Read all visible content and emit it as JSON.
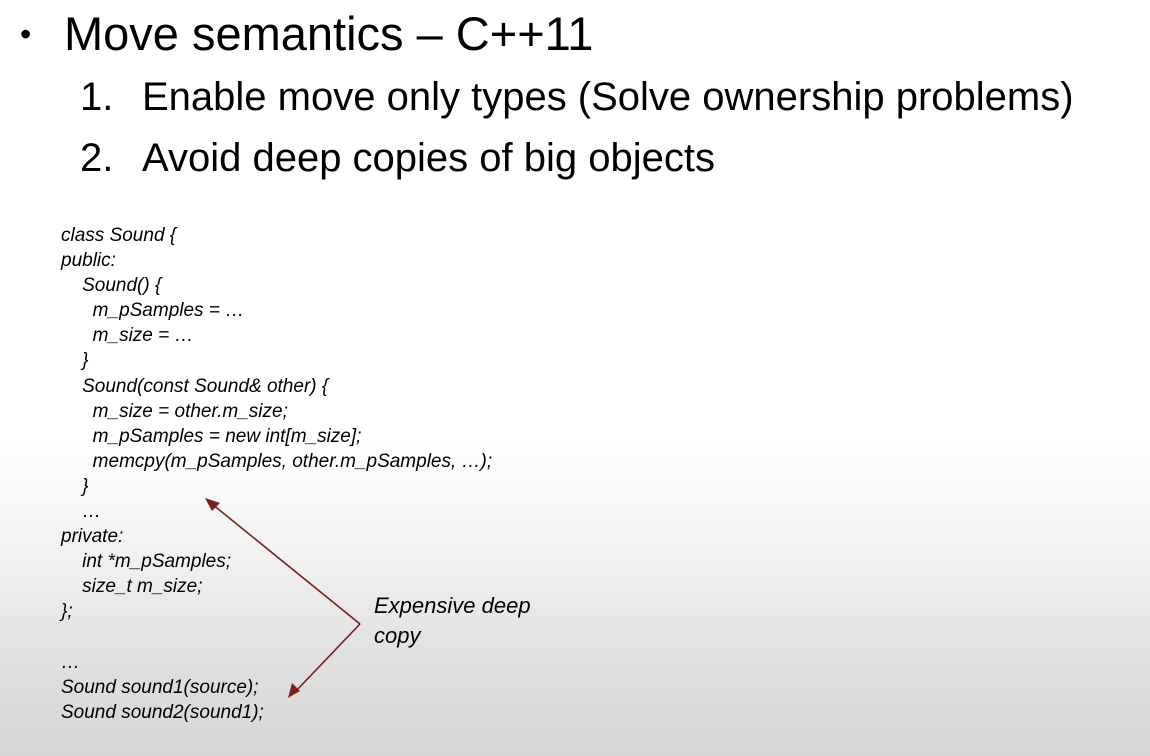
{
  "slide": {
    "bullet": "•",
    "heading": "Move semantics – C++11",
    "items": [
      {
        "num": "1.",
        "text": "Enable move only types (Solve ownership problems)"
      },
      {
        "num": "2.",
        "text": "Avoid deep copies of big objects"
      }
    ],
    "code_lines": [
      "class Sound {",
      "public:",
      "    Sound() {",
      "      m_pSamples = …",
      "      m_size = …",
      "    }",
      "    Sound(const Sound& other) {",
      "      m_size = other.m_size;",
      "      m_pSamples = new int[m_size];",
      "      memcpy(m_pSamples, other.m_pSamples, …);",
      "    }",
      "    …",
      "private:",
      "    int *m_pSamples;",
      "    size_t m_size;",
      "};",
      "",
      "…",
      "Sound sound1(source);",
      "Sound sound2(sound1);"
    ],
    "annotation": {
      "line1": "Expensive deep",
      "line2": "copy"
    },
    "arrow_color": "#7a1e1e"
  }
}
